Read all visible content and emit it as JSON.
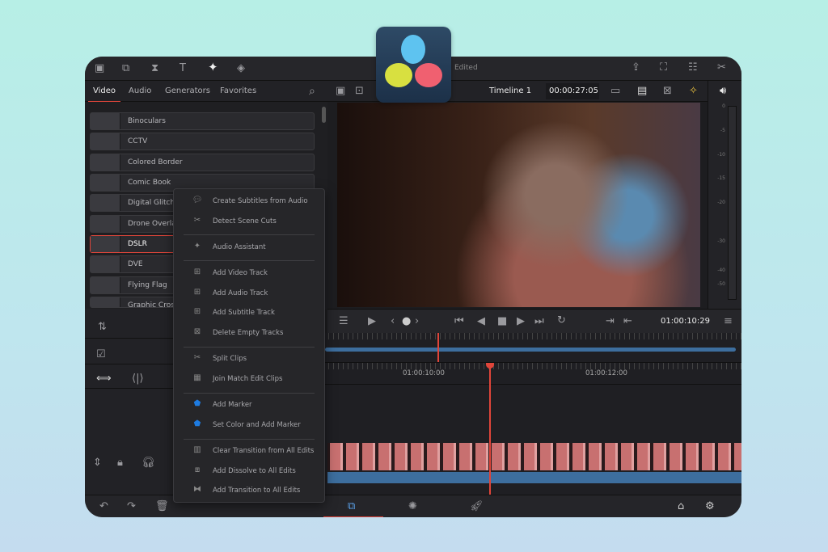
{
  "header": {
    "status": "Edited",
    "timeline_name": "Timeline 1",
    "timecode": "00:00:27:05"
  },
  "tabs": [
    {
      "label": "Video"
    },
    {
      "label": "Audio"
    },
    {
      "label": "Generators"
    },
    {
      "label": "Favorites"
    }
  ],
  "effects": [
    {
      "label": "Binoculars"
    },
    {
      "label": "CCTV"
    },
    {
      "label": "Colored Border"
    },
    {
      "label": "Comic Book"
    },
    {
      "label": "Digital Glitch"
    },
    {
      "label": "Drone Overlay"
    },
    {
      "label": "DSLR"
    },
    {
      "label": "DVE"
    },
    {
      "label": "Flying Flag"
    },
    {
      "label": "Graphic Cross"
    }
  ],
  "meter_ticks": [
    "0",
    "-5",
    "-10",
    "-15",
    "-20",
    "-30",
    "-40",
    "-50"
  ],
  "transport": {
    "timecode": "01:00:10:29"
  },
  "ruler": {
    "labels": [
      "01:00:10:00",
      "01:00:12:00"
    ]
  },
  "context_menu": {
    "items": [
      {
        "label": "Create Subtitles from Audio",
        "icon": "subtitle-audio-icon"
      },
      {
        "label": "Detect Scene Cuts",
        "icon": "scene-cut-icon"
      },
      {
        "label": "Audio Assistant",
        "icon": "audio-assistant-icon"
      },
      {
        "label": "Add Video Track",
        "icon": "add-video-track-icon"
      },
      {
        "label": "Add Audio Track",
        "icon": "add-audio-track-icon"
      },
      {
        "label": "Add Subtitle Track",
        "icon": "add-subtitle-track-icon"
      },
      {
        "label": "Delete Empty Tracks",
        "icon": "delete-tracks-icon"
      },
      {
        "label": "Split Clips",
        "icon": "scissors-icon"
      },
      {
        "label": "Join Match Edit Clips",
        "icon": "join-clips-icon"
      },
      {
        "label": "Add Marker",
        "icon": "marker-icon"
      },
      {
        "label": "Set Color and Add Marker",
        "icon": "color-marker-icon"
      },
      {
        "label": "Clear Transition from All Edits",
        "icon": "clear-transition-icon"
      },
      {
        "label": "Add Dissolve to All Edits",
        "icon": "dissolve-icon"
      },
      {
        "label": "Add Transition to All Edits",
        "icon": "transition-icon"
      }
    ]
  },
  "colors": {
    "accent": "#e0453a",
    "marker": "#1e7be0",
    "clip_audio": "#3d6e9e"
  }
}
